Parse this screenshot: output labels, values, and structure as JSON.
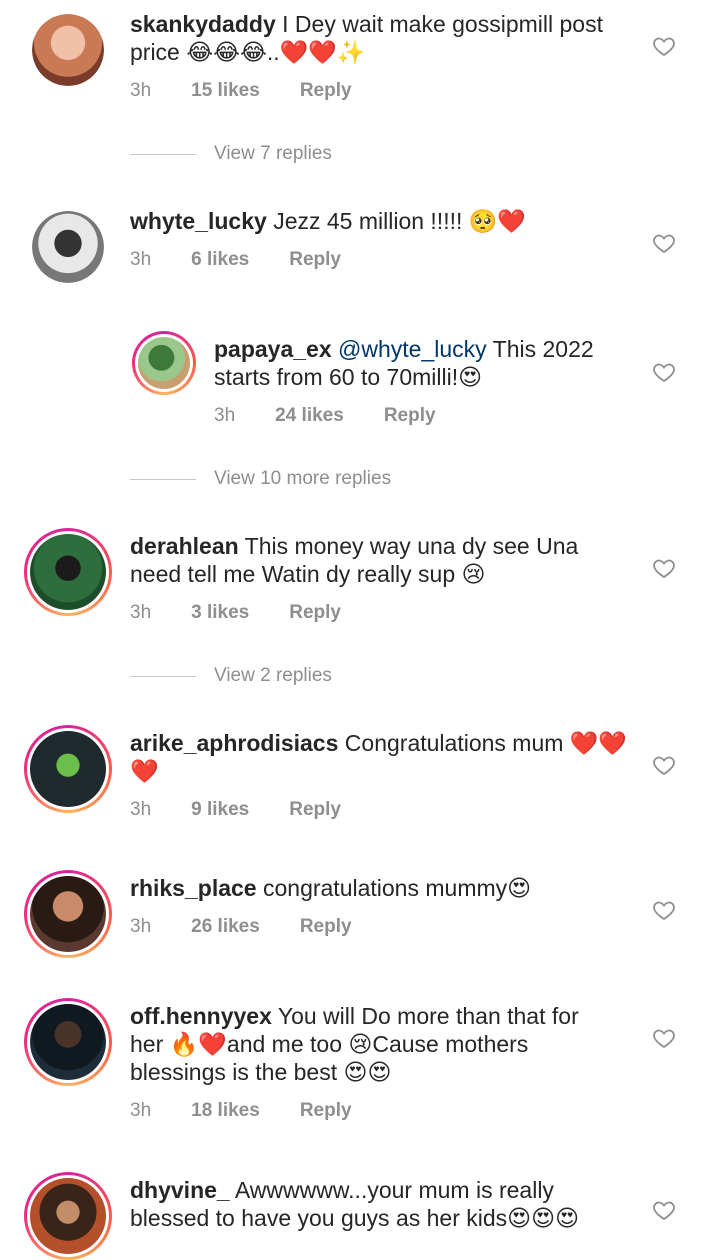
{
  "comments": [
    {
      "user": "skankydaddy",
      "text": "I Dey wait make gossipmill post price 😂😂😂..❤️❤️✨",
      "time": "3h",
      "likes": "15 likes",
      "reply": "Reply"
    },
    {
      "user": "whyte_lucky",
      "text": "Jezz 45 million !!!!! 🥺❤️",
      "time": "3h",
      "likes": "6 likes",
      "reply": "Reply"
    },
    {
      "user": "papaya_ex",
      "mention": "@whyte_lucky",
      "text": "This 2022 starts from 60 to 70milli!😍",
      "time": "3h",
      "likes": "24 likes",
      "reply": "Reply"
    },
    {
      "user": "derahlean",
      "text": "This money way una dy see Una need tell me Watin dy really sup 😢",
      "time": "3h",
      "likes": "3 likes",
      "reply": "Reply"
    },
    {
      "user": "arike_aphrodisiacs",
      "text": "Congratulations mum ❤️❤️❤️",
      "time": "3h",
      "likes": "9 likes",
      "reply": "Reply"
    },
    {
      "user": "rhiks_place",
      "text": "congratulations mummy😍",
      "time": "3h",
      "likes": "26 likes",
      "reply": "Reply"
    },
    {
      "user": "off.hennyyex",
      "text": "You will Do more than that for her 🔥❤️and me too 😢Cause mothers blessings is the best 😍😍",
      "time": "3h",
      "likes": "18 likes",
      "reply": "Reply"
    },
    {
      "user": "dhyvine_",
      "text": "Awwwwww...your mum is really blessed to have you guys as her kids😍😍😍"
    }
  ],
  "view_replies": [
    {
      "label": "View 7 replies"
    },
    {
      "label": "View 10 more replies"
    },
    {
      "label": "View 2 replies"
    }
  ],
  "colors": {
    "text": "#262626",
    "meta": "#8e8e8e",
    "mention": "#00376b",
    "heart_outline": "#8e8e8e"
  },
  "icons": {
    "like": "heart-outline-icon"
  }
}
